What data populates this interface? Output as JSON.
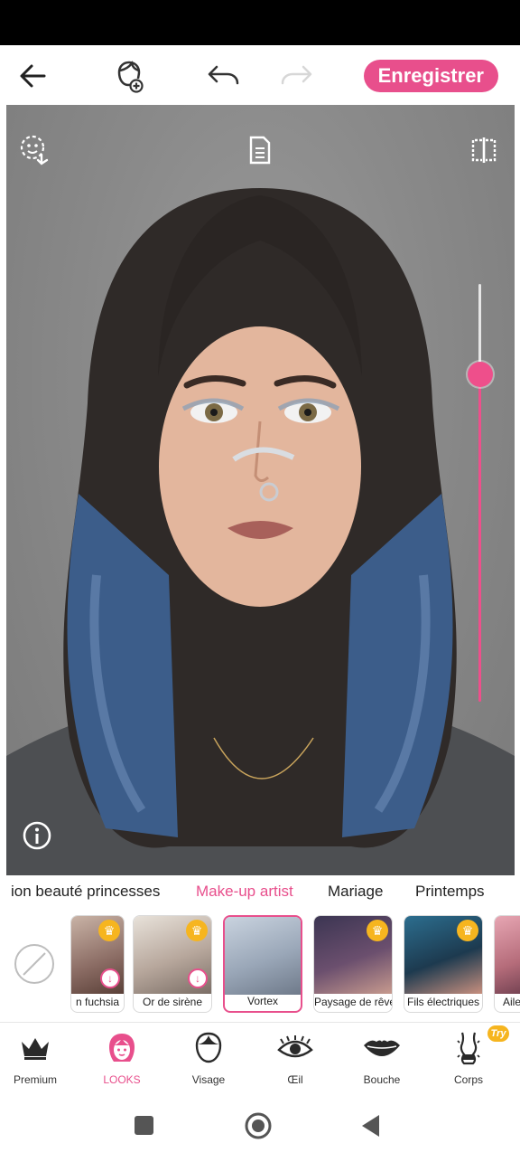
{
  "topbar": {
    "back_icon": "arrow-left-icon",
    "add_face_icon": "face-add-icon",
    "undo_icon": "undo-icon",
    "redo_icon": "redo-icon",
    "save_label": "Enregistrer",
    "accent": "#e84f8c"
  },
  "photo_overlay": {
    "face_detect_icon": "face-touch-icon",
    "notes_icon": "document-icon",
    "compare_icon": "compare-split-icon",
    "info_icon": "info-icon",
    "intensity_level": 0.78
  },
  "categories": [
    {
      "label": "ion beauté princesses",
      "active": false
    },
    {
      "label": "Make-up artist",
      "active": true
    },
    {
      "label": "Mariage",
      "active": false
    },
    {
      "label": "Printemps",
      "active": false
    }
  ],
  "looks": [
    {
      "label": "n fuchsia",
      "premium": true,
      "download": true
    },
    {
      "label": "Or de sirène",
      "premium": true,
      "download": true
    },
    {
      "label": "Vortex",
      "premium": false,
      "download": false,
      "selected": true
    },
    {
      "label": "Paysage de rêve",
      "premium": true,
      "download": false
    },
    {
      "label": "Fils électriques",
      "premium": true,
      "download": false
    },
    {
      "label": "Aile",
      "premium": false,
      "download": false
    }
  ],
  "tabs": [
    {
      "label": "Premium",
      "icon": "crown-icon"
    },
    {
      "label": "LOOKS",
      "icon": "girl-face-icon",
      "active": true
    },
    {
      "label": "Visage",
      "icon": "face-outline-icon"
    },
    {
      "label": "Œil",
      "icon": "eye-icon"
    },
    {
      "label": "Bouche",
      "icon": "lips-icon"
    },
    {
      "label": "Corps",
      "icon": "body-icon",
      "badge": "Try"
    }
  ],
  "nav": {
    "recent_icon": "square-icon",
    "home_icon": "circle-icon",
    "back_icon": "triangle-back-icon"
  }
}
